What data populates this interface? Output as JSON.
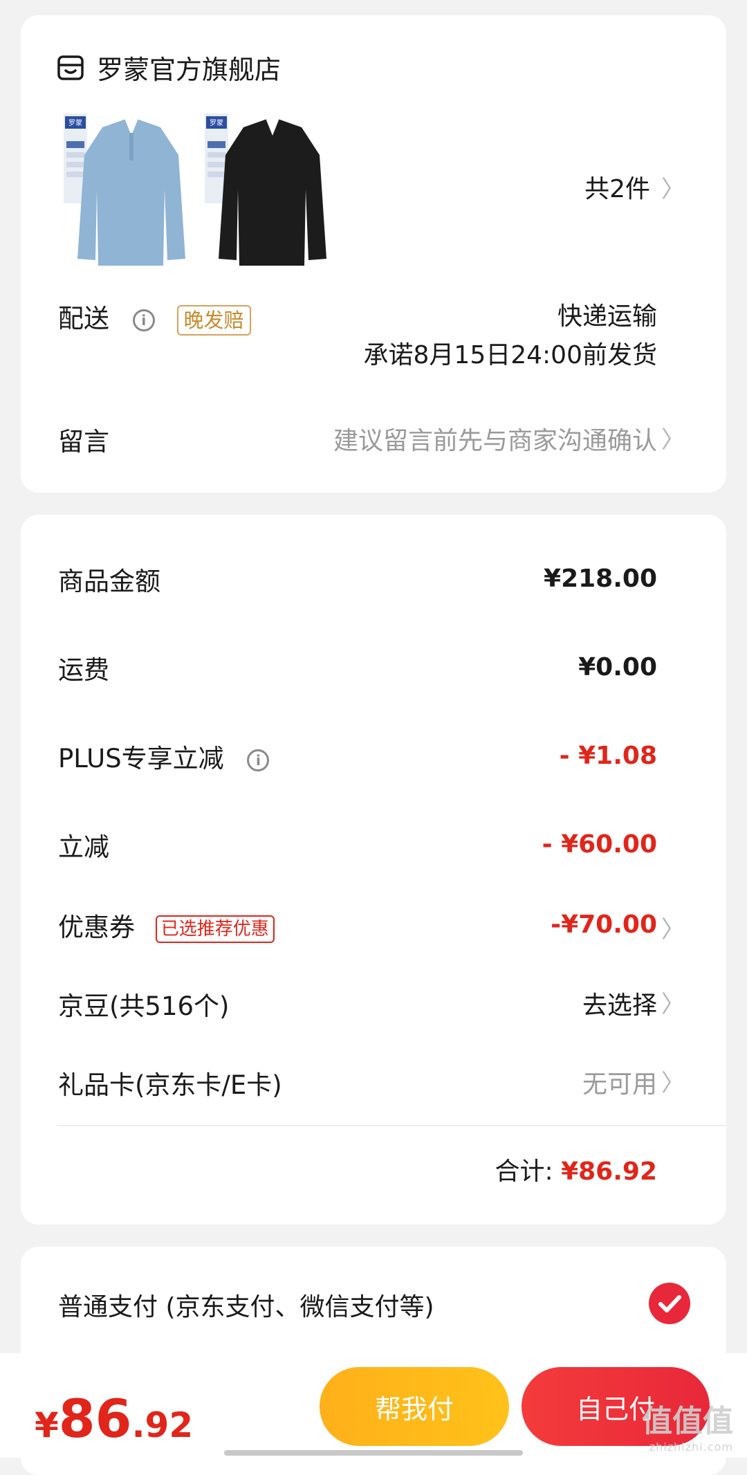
{
  "shop": {
    "name": "罗蒙官方旗舰店",
    "item_count": "共2件",
    "products": [
      {
        "color": "#8fb4d4",
        "tag": "罗蒙"
      },
      {
        "color": "#1c1c1c",
        "tag": "罗蒙"
      }
    ]
  },
  "delivery": {
    "label": "配送",
    "badge": "晚发赔",
    "method": "快递运输",
    "promise": "承诺8月15日24:00前发货"
  },
  "message": {
    "label": "留言",
    "placeholder": "建议留言前先与商家沟通确认"
  },
  "amounts": {
    "goods_label": "商品金额",
    "goods_value": "¥218.00",
    "shipping_label": "运费",
    "shipping_value": "¥0.00",
    "plus_label": "PLUS专享立减",
    "plus_value": "- ¥1.08",
    "discount_label": "立减",
    "discount_value": "- ¥60.00",
    "coupon_label": "优惠券",
    "coupon_badge": "已选推荐优惠",
    "coupon_value": "-¥70.00",
    "jingdou_label": "京豆(共516个)",
    "jingdou_value": "去选择",
    "giftcard_label": "礼品卡(京东卡/E卡)",
    "giftcard_value": "无可用",
    "total_label": "合计:",
    "total_value": "¥86.92"
  },
  "payment": {
    "option_label": "普通支付 (京东支付、微信支付等)"
  },
  "bottom": {
    "price_symbol": "¥",
    "price_int": "86",
    "price_dec": ".92",
    "help_pay": "帮我付",
    "self_pay": "自己付"
  },
  "watermark": {
    "text": "值值值",
    "site": "zhizhizhi.com"
  },
  "colors": {
    "accent_red": "#e1251b",
    "button_yellow": "#ffb01a",
    "button_red": "#e8283a"
  }
}
